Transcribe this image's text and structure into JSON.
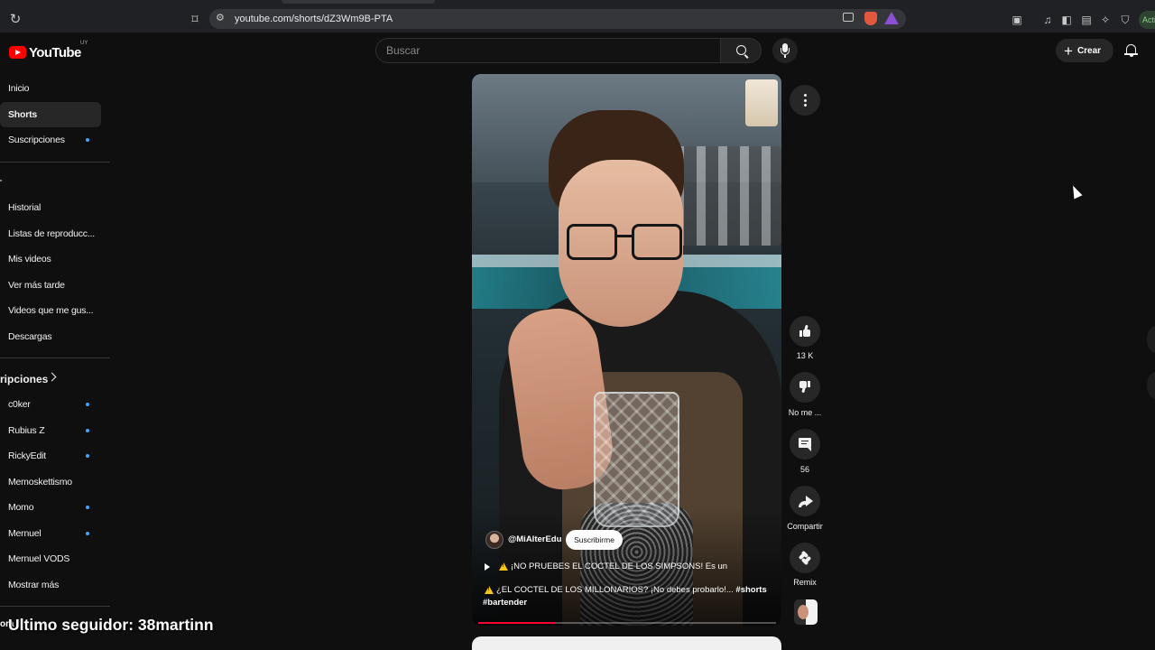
{
  "browser": {
    "url": "youtube.com/shorts/dZ3Wm9B-PTA",
    "profile_badge": "Acti"
  },
  "header": {
    "logo_text": "YouTube",
    "country_code": "UY",
    "search_placeholder": "Buscar",
    "create_label": "Crear"
  },
  "sidebar": {
    "main": [
      {
        "label": "Inicio"
      },
      {
        "label": "Shorts",
        "active": true
      },
      {
        "label": "Suscripciones"
      }
    ],
    "you": [
      {
        "label": "Historial"
      },
      {
        "label": "Listas de reproducc..."
      },
      {
        "label": "Mis videos"
      },
      {
        "label": "Ver más tarde"
      },
      {
        "label": "Videos que me gus..."
      },
      {
        "label": "Descargas"
      }
    ],
    "subscriptions_title": "ripciones",
    "subscriptions": [
      {
        "label": "c0ker"
      },
      {
        "label": "Rubius Z"
      },
      {
        "label": "RickyEdit"
      },
      {
        "label": "Memoskettismo"
      },
      {
        "label": "Momo"
      },
      {
        "label": "Mernuel"
      },
      {
        "label": "Mernuel VODS"
      },
      {
        "label": "Mostrar más"
      }
    ]
  },
  "overlay": {
    "prefix": "ora",
    "last_follower": "Ultimo seguidor: 38martinn"
  },
  "short": {
    "channel": "@MiAlterEdu",
    "subscribe_label": "Suscribirme",
    "title_line1": "¡NO PRUEBES EL COCTEL DE LOS SIMPSONS! Es un",
    "title_line2": "¿EL COCTEL DE LOS MILLONARIOS? ¡No debes probarlo!...",
    "hashtag_shorts": "#shorts",
    "hashtag_bartender": "#bartender",
    "progress": 0.26
  },
  "actions": {
    "likes": "13 K",
    "dislike_label": "No me ...",
    "comments": "56",
    "share_label": "Compartir",
    "remix_label": "Remix"
  },
  "colors": {
    "background": "#0f0f0f",
    "brand_red": "#ff0000",
    "notification_dot": "#3ea6ff",
    "progress_red": "#ff0033"
  }
}
